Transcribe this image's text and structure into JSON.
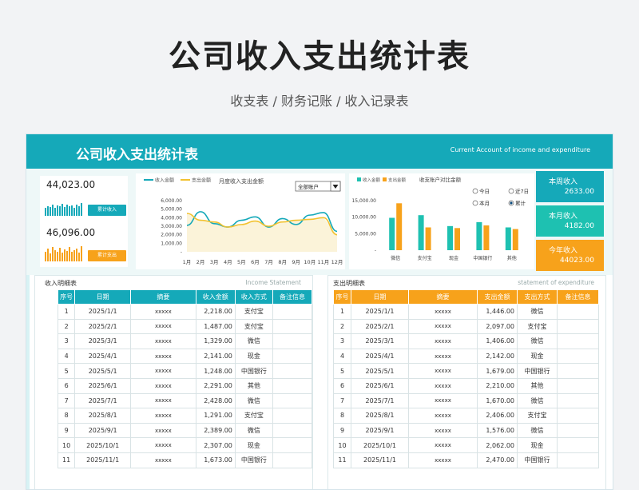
{
  "page": {
    "title": "公司收入支出统计表",
    "subtitle": "收支表 / 财务记账 / 收入记录表"
  },
  "banner": {
    "title": "公司收入支出统计表",
    "subtitle": "Current Account of income and expenditure"
  },
  "kpi": {
    "income_total": "44,023.00",
    "income_btn": "累计收入",
    "expense_total": "46,096.00",
    "expense_btn": "累计支出",
    "income_color": "#15a9b9",
    "expense_color": "#f7a21b",
    "income_bars": [
      0.5,
      0.6,
      0.55,
      0.7,
      0.5,
      0.65,
      0.6,
      0.75,
      0.55,
      0.7,
      0.6,
      0.65,
      0.5,
      0.7,
      0.6,
      0.8
    ],
    "expense_bars": [
      0.6,
      0.8,
      0.5,
      0.9,
      0.7,
      0.6,
      0.85,
      0.55,
      0.75,
      0.65,
      0.9,
      0.6,
      0.7,
      0.8,
      0.55,
      0.95
    ]
  },
  "line_chart": {
    "chart_data": {
      "type": "line",
      "title": "月度收入支出金额",
      "x": [
        "1月",
        "2月",
        "3月",
        "4月",
        "5月",
        "6月",
        "7月",
        "8月",
        "9月",
        "10月",
        "11月",
        "12月"
      ],
      "yticks": [
        "6,000.00",
        "5,000.00",
        "4,000.00",
        "3,000.00",
        "2,000.00",
        "1,000.00",
        "-"
      ],
      "ylim": [
        0,
        6000
      ],
      "series": [
        {
          "name": "收入金额",
          "color": "#15a9b9",
          "values": [
            3100,
            4700,
            3300,
            2900,
            3700,
            4100,
            2900,
            3900,
            3200,
            4300,
            4600,
            2400
          ]
        },
        {
          "name": "支出金额",
          "color": "#f2c230",
          "values": [
            4500,
            3700,
            3500,
            2900,
            3200,
            3600,
            3000,
            3500,
            3700,
            3800,
            4000,
            2000
          ]
        }
      ]
    },
    "dropdown_value": "全部账户"
  },
  "bar_chart": {
    "chart_data": {
      "type": "bar",
      "title": "收支账户对比金额",
      "categories": [
        "微信",
        "支付宝",
        "现金",
        "中国银行",
        "其他"
      ],
      "yticks": [
        "15,000.00",
        "10,000.00",
        "5,000.00",
        "-"
      ],
      "ylim": [
        0,
        15000
      ],
      "series": [
        {
          "name": "收入金额",
          "color": "#1ec1b1",
          "values": [
            9800,
            10600,
            7300,
            8500,
            6900
          ]
        },
        {
          "name": "支出金额",
          "color": "#f7a21b",
          "values": [
            14200,
            6900,
            6700,
            7500,
            6400
          ]
        }
      ]
    },
    "radios": [
      {
        "label": "今日",
        "checked": false
      },
      {
        "label": "近7日",
        "checked": false
      },
      {
        "label": "本月",
        "checked": false
      },
      {
        "label": "累计",
        "checked": true
      }
    ]
  },
  "stats": [
    {
      "label": "本周收入",
      "value": "2633.00",
      "color": "#15a9b9"
    },
    {
      "label": "本月收入",
      "value": "4182.00",
      "color": "#1ec1b1"
    },
    {
      "label": "今年收入",
      "value": "44023.00",
      "color": "#f7a21b"
    }
  ],
  "income_table": {
    "title": "收入明细表",
    "title_en": "Income Statement",
    "header_color": "#15a9b9",
    "columns": [
      "序号",
      "日期",
      "摘要",
      "收入金额",
      "收入方式",
      "备注信息"
    ],
    "rows": [
      [
        "1",
        "2025/1/1",
        "xxxxx",
        "2,218.00",
        "支付宝",
        ""
      ],
      [
        "2",
        "2025/2/1",
        "xxxxx",
        "1,487.00",
        "支付宝",
        ""
      ],
      [
        "3",
        "2025/3/1",
        "xxxxx",
        "1,329.00",
        "微信",
        ""
      ],
      [
        "4",
        "2025/4/1",
        "xxxxx",
        "2,141.00",
        "现金",
        ""
      ],
      [
        "5",
        "2025/5/1",
        "xxxxx",
        "1,248.00",
        "中国银行",
        ""
      ],
      [
        "6",
        "2025/6/1",
        "xxxxx",
        "2,291.00",
        "其他",
        ""
      ],
      [
        "7",
        "2025/7/1",
        "xxxxx",
        "2,428.00",
        "微信",
        ""
      ],
      [
        "8",
        "2025/8/1",
        "xxxxx",
        "1,291.00",
        "支付宝",
        ""
      ],
      [
        "9",
        "2025/9/1",
        "xxxxx",
        "2,389.00",
        "微信",
        ""
      ],
      [
        "10",
        "2025/10/1",
        "xxxxx",
        "2,307.00",
        "现金",
        ""
      ],
      [
        "11",
        "2025/11/1",
        "xxxxx",
        "1,673.00",
        "中国银行",
        ""
      ]
    ]
  },
  "expense_table": {
    "title": "支出明细表",
    "title_en": "statement of expenditure",
    "header_color": "#f7a21b",
    "columns": [
      "序号",
      "日期",
      "摘要",
      "支出金额",
      "支出方式",
      "备注信息"
    ],
    "rows": [
      [
        "1",
        "2025/1/1",
        "xxxxx",
        "1,446.00",
        "微信",
        ""
      ],
      [
        "2",
        "2025/2/1",
        "xxxxx",
        "2,097.00",
        "支付宝",
        ""
      ],
      [
        "3",
        "2025/3/1",
        "xxxxx",
        "1,406.00",
        "微信",
        ""
      ],
      [
        "4",
        "2025/4/1",
        "xxxxx",
        "2,142.00",
        "现金",
        ""
      ],
      [
        "5",
        "2025/5/1",
        "xxxxx",
        "1,679.00",
        "中国银行",
        ""
      ],
      [
        "6",
        "2025/6/1",
        "xxxxx",
        "2,210.00",
        "其他",
        ""
      ],
      [
        "7",
        "2025/7/1",
        "xxxxx",
        "1,670.00",
        "微信",
        ""
      ],
      [
        "8",
        "2025/8/1",
        "xxxxx",
        "2,406.00",
        "支付宝",
        ""
      ],
      [
        "9",
        "2025/9/1",
        "xxxxx",
        "1,576.00",
        "微信",
        ""
      ],
      [
        "10",
        "2025/10/1",
        "xxxxx",
        "2,062.00",
        "现金",
        ""
      ],
      [
        "11",
        "2025/11/1",
        "xxxxx",
        "2,470.00",
        "中国银行",
        ""
      ]
    ]
  }
}
